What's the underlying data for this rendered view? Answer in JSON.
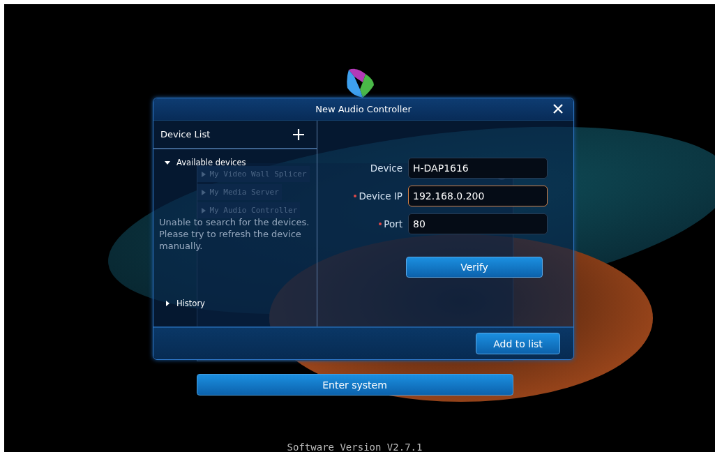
{
  "background_list": {
    "rows": [
      {
        "label": "My Video Wall Splicer"
      },
      {
        "label": "My Media Server"
      },
      {
        "label": "My Audio Controller"
      }
    ]
  },
  "dialog": {
    "title": "New Audio Controller",
    "device_list": {
      "title": "Device List",
      "groups": [
        {
          "label": "Available devices",
          "expanded": true,
          "message": "Unable to search for the devices. Please try to refresh the device manually."
        },
        {
          "label": "History",
          "expanded": false
        }
      ]
    },
    "fields": [
      {
        "label": "Device",
        "value": "H-DAP1616",
        "required": false,
        "focused": false
      },
      {
        "label": "Device IP",
        "value": "192.168.0.200",
        "required": true,
        "focused": true
      },
      {
        "label": "Port",
        "value": "80",
        "required": true,
        "focused": false
      }
    ],
    "verify_button": "Verify",
    "add_button": "Add to list"
  },
  "enter_button": "Enter system",
  "version": "Software Version V2.7.1"
}
